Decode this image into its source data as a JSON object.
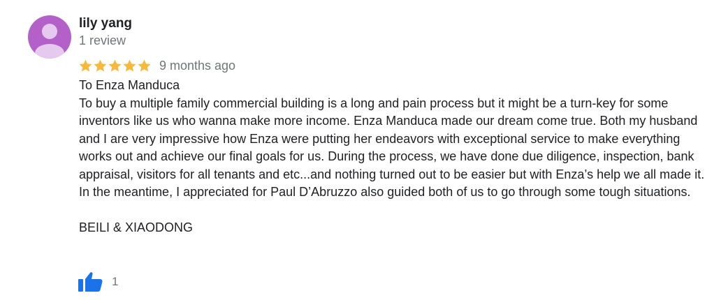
{
  "reviewer": {
    "name": "lily yang",
    "review_count": "1 review",
    "avatar_color": "#b361c9"
  },
  "review": {
    "rating": 5,
    "rating_max": 5,
    "star_color": "#f5b93e",
    "time_ago": "9 months ago",
    "greeting": "To Enza Manduca",
    "body": "To buy a multiple family commercial building is a long and pain process but it might be a turn-key for some inventors like us who wanna make more income. Enza Manduca made our dream come true. Both my husband and I are very impressive how Enza were putting her endeavors with exceptional service to make everything works out and achieve our final goals for us. During the process, we have done due diligence, inspection, bank appraisal, visitors for all tenants and etc...and nothing turned out to be easier but with Enza’s help we all made it. In the meantime, I appreciated for Paul D’Abruzzo also guided both of us to go through some tough situations.",
    "signature": "BEILI & XIAODONG"
  },
  "actions": {
    "like_icon": "thumbs-up-icon",
    "like_color": "#1a73e8",
    "like_count": "1"
  }
}
